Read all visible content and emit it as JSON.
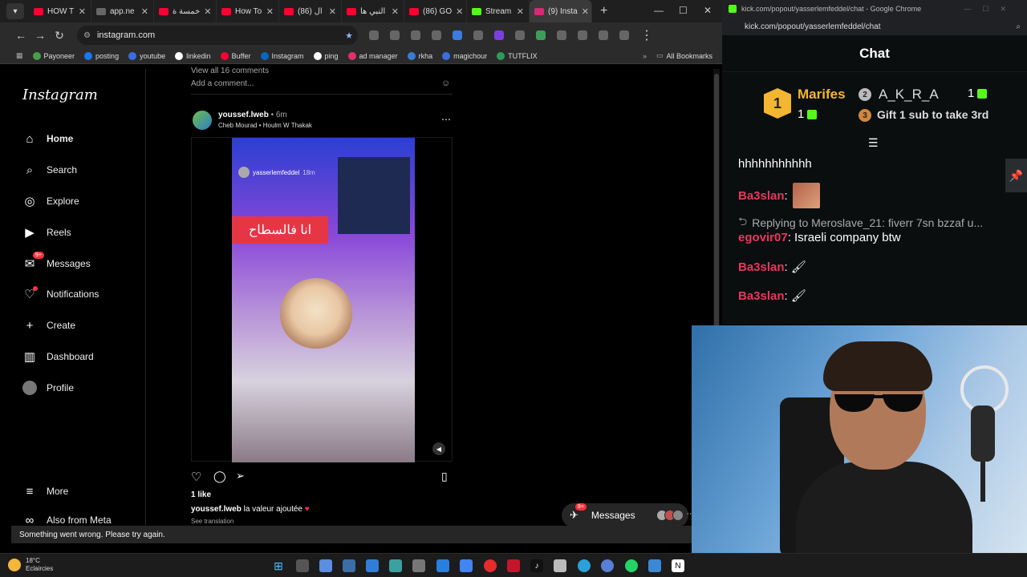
{
  "browser": {
    "tabs": [
      {
        "label": "HOW T",
        "fav": "#ff0033",
        "active": false
      },
      {
        "label": "app.ne",
        "fav": "#666666",
        "active": false
      },
      {
        "label": "خمسة ة",
        "fav": "#ff0033",
        "active": false
      },
      {
        "label": "How To",
        "fav": "#ff0033",
        "active": false
      },
      {
        "label": "(86) ال",
        "fav": "#ff0033",
        "active": false
      },
      {
        "label": "النبي ها",
        "fav": "#ff0033",
        "active": false
      },
      {
        "label": "(86) GO",
        "fav": "#ff0033",
        "active": false
      },
      {
        "label": "Stream",
        "fav": "#53fc18",
        "active": false
      },
      {
        "label": "(9) Insta",
        "fav": "#d62976",
        "active": true
      }
    ],
    "url": "instagram.com",
    "bookmarks": [
      "Payoneer",
      "posting",
      "youtube",
      "linkedin",
      "Buffer",
      "Instagram",
      "ping",
      "ad manager",
      "rkha",
      "magichour",
      "TUTFLIX"
    ],
    "all_bookmarks": "All Bookmarks"
  },
  "instagram": {
    "logo": "Instagram",
    "nav": [
      {
        "label": "Home",
        "icon": "home-icon",
        "glyph": "⌂"
      },
      {
        "label": "Search",
        "icon": "search-icon",
        "glyph": "⌕"
      },
      {
        "label": "Explore",
        "icon": "compass-icon",
        "glyph": "◎"
      },
      {
        "label": "Reels",
        "icon": "reels-icon",
        "glyph": "▶"
      },
      {
        "label": "Messages",
        "icon": "messenger-icon",
        "glyph": "✉",
        "badge": "9+"
      },
      {
        "label": "Notifications",
        "icon": "heart-icon",
        "glyph": "♡"
      },
      {
        "label": "Create",
        "icon": "plus-icon",
        "glyph": "+"
      },
      {
        "label": "Dashboard",
        "icon": "dashboard-icon",
        "glyph": "▥"
      },
      {
        "label": "Profile",
        "icon": "profile-avatar",
        "glyph": "●"
      }
    ],
    "more": "More",
    "also_from_meta": "Also from Meta",
    "post": {
      "view_comments": "View all 16 comments",
      "add_comment": "Add a comment...",
      "username": "youssef.lweb",
      "time": "• 6m",
      "audio": "Cheb Mourad • Houlm W Thakak",
      "story_handle": "yasserlemfeddel",
      "story_time": "18m",
      "arabic_caption": "انا فالسطاح",
      "likes": "1 like",
      "caption_user": "youssef.lweb",
      "caption_text": "la valeur ajoutée",
      "see_translation": "See translation"
    },
    "messages_pill": {
      "label": "Messages",
      "badge": "9+"
    },
    "toast": "Something went wrong. Please try again."
  },
  "chat": {
    "window_title": "kick.com/popout/yasserlemfeddel/chat - Google Chrome",
    "url": "kick.com/popout/yasserlemfeddel/chat",
    "header": "Chat",
    "leaderboard": {
      "first": {
        "rank": "1",
        "name": "Marifes",
        "count": "1"
      },
      "second": {
        "rank": "2",
        "name": "A_K_R_A",
        "count": "1"
      },
      "third": {
        "rank": "3",
        "text": "Gift 1 sub to take 3rd"
      }
    },
    "messages": [
      {
        "user": "",
        "text": "hhhhhhhhhhh",
        "color": "#ffffff"
      },
      {
        "user": "Ba3slan",
        "text": ":",
        "color": "#e8375e",
        "emote": true
      },
      {
        "user": "",
        "text": "Replying to Meroslave_21: fiverr 7sn bzzaf u...",
        "color": "#aaaaaa",
        "reply": true
      },
      {
        "user": "egovir07",
        "text": ": Israeli company btw",
        "color": "#e8375e"
      },
      {
        "user": "Ba3slan",
        "text": ": 🖌",
        "color": "#e8375e"
      },
      {
        "user": "Ba3slan",
        "text": ": 🖌",
        "color": "#e8375e"
      }
    ]
  },
  "taskbar": {
    "temp": "18°C",
    "condition": "Eclaircies"
  }
}
